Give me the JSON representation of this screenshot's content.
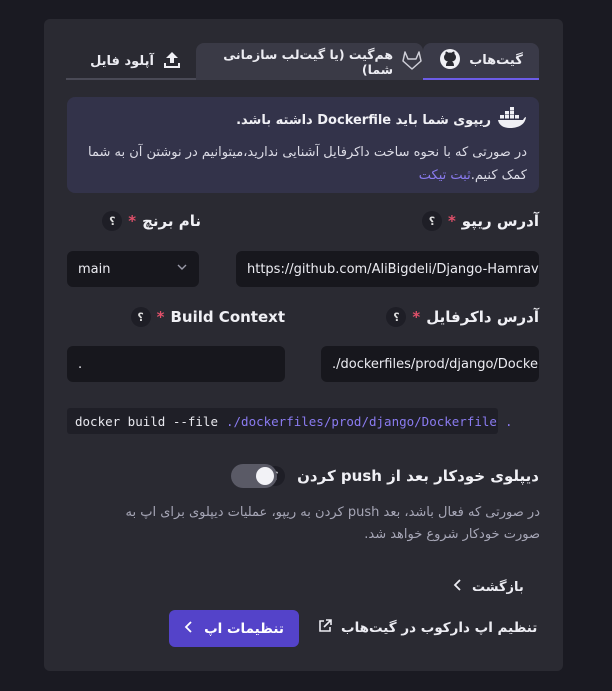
{
  "tabs": {
    "github": "گیت‌هاب",
    "gitlab": "هم‌گیت (یا گیت‌لب سازمانی شما)",
    "upload": "آپلود فایل"
  },
  "info": {
    "title": "ریپوی شما باید Dockerfile داشته باشد.",
    "text": "در صورتی که با نحوه ساخت داکرفایل آشنایی ندارید،میتوانیم در نوشتن آن به شما کمک کنیم.",
    "link": "ثبت تیکت"
  },
  "repo": {
    "label": "آدرس ریپو",
    "required": "*",
    "value": "https://github.com/AliBigdeli/Django-Hamrav"
  },
  "branch": {
    "label": "نام برنچ",
    "required": "*",
    "value": "main"
  },
  "dockerfile": {
    "label": "آدرس داکرفایل",
    "required": "*",
    "value": "./dockerfiles/prod/django/Dockerfile"
  },
  "build_context": {
    "label": "Build Context",
    "required": "*",
    "value": "."
  },
  "command": {
    "prefix": "docker build --file",
    "path": "./dockerfiles/prod/django/Dockerfile",
    "context": "."
  },
  "auto_deploy": {
    "label": "دیپلوی خودکار بعد از push کردن",
    "enabled": true,
    "description": "در صورتی که فعال باشد، بعد push کردن به ریپو، عملیات دیپلوی برای اپ به صورت خودکار شروع خواهد شد."
  },
  "help_symbol": "؟",
  "back_label": "بازگشت",
  "primary_button": "تنظیمات اپ",
  "github_app_link": "تنظیم اپ دارکوب در گیت‌هاب",
  "colors": {
    "accent": "#5443c9",
    "link": "#8a7bf0",
    "required": "#e0506a"
  }
}
